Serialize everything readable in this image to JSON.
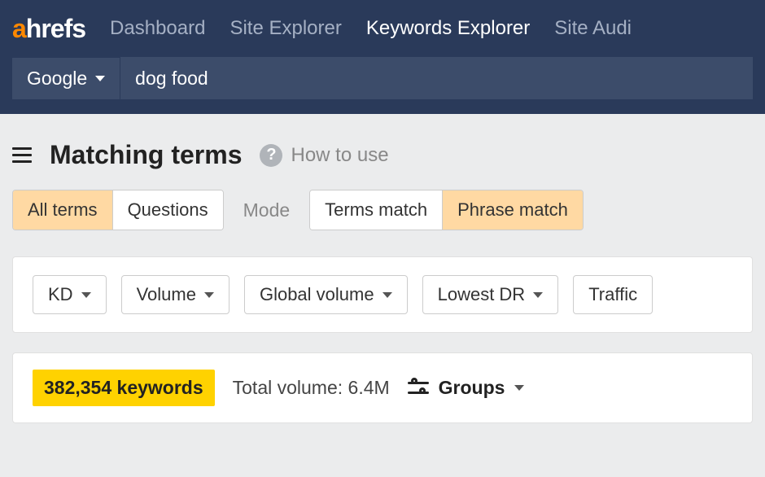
{
  "logo": {
    "prefix": "a",
    "rest": "hrefs"
  },
  "nav": {
    "items": [
      {
        "label": "Dashboard",
        "active": false
      },
      {
        "label": "Site Explorer",
        "active": false
      },
      {
        "label": "Keywords Explorer",
        "active": true
      },
      {
        "label": "Site Audi",
        "active": false
      }
    ]
  },
  "search": {
    "engine": "Google",
    "query": "dog food"
  },
  "page": {
    "title": "Matching terms",
    "help_label": "How to use"
  },
  "type_tabs": {
    "items": [
      {
        "label": "All terms",
        "active": true
      },
      {
        "label": "Questions",
        "active": false
      }
    ]
  },
  "mode_label": "Mode",
  "mode_tabs": {
    "items": [
      {
        "label": "Terms match",
        "active": false
      },
      {
        "label": "Phrase match",
        "active": true
      }
    ]
  },
  "filters": {
    "items": [
      {
        "label": "KD"
      },
      {
        "label": "Volume"
      },
      {
        "label": "Global volume"
      },
      {
        "label": "Lowest DR"
      },
      {
        "label": "Traffic"
      }
    ]
  },
  "summary": {
    "keyword_count": "382,354 keywords",
    "total_volume": "Total volume: 6.4M",
    "groups_label": "Groups"
  }
}
